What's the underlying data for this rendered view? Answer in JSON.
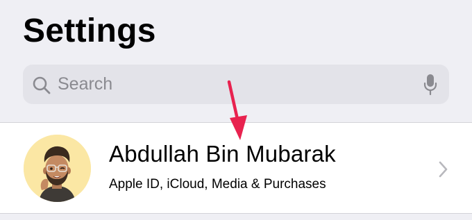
{
  "header": {
    "title": "Settings"
  },
  "search": {
    "placeholder": "Search",
    "icon": "search-icon",
    "mic_icon": "microphone-icon"
  },
  "profile": {
    "name": "Abdullah Bin Mubarak",
    "subtitle": "Apple ID, iCloud, Media & Purchases",
    "avatar_icon": "memoji-avatar",
    "chevron_icon": "chevron-right-icon"
  },
  "annotation": {
    "color": "#e8224f",
    "icon": "down-arrow-icon"
  },
  "colors": {
    "background": "#efeff4",
    "search_field": "#e3e3e9",
    "cell": "#ffffff",
    "avatar_bg": "#fbe7a4",
    "secondary_text": "#8a8a90"
  }
}
